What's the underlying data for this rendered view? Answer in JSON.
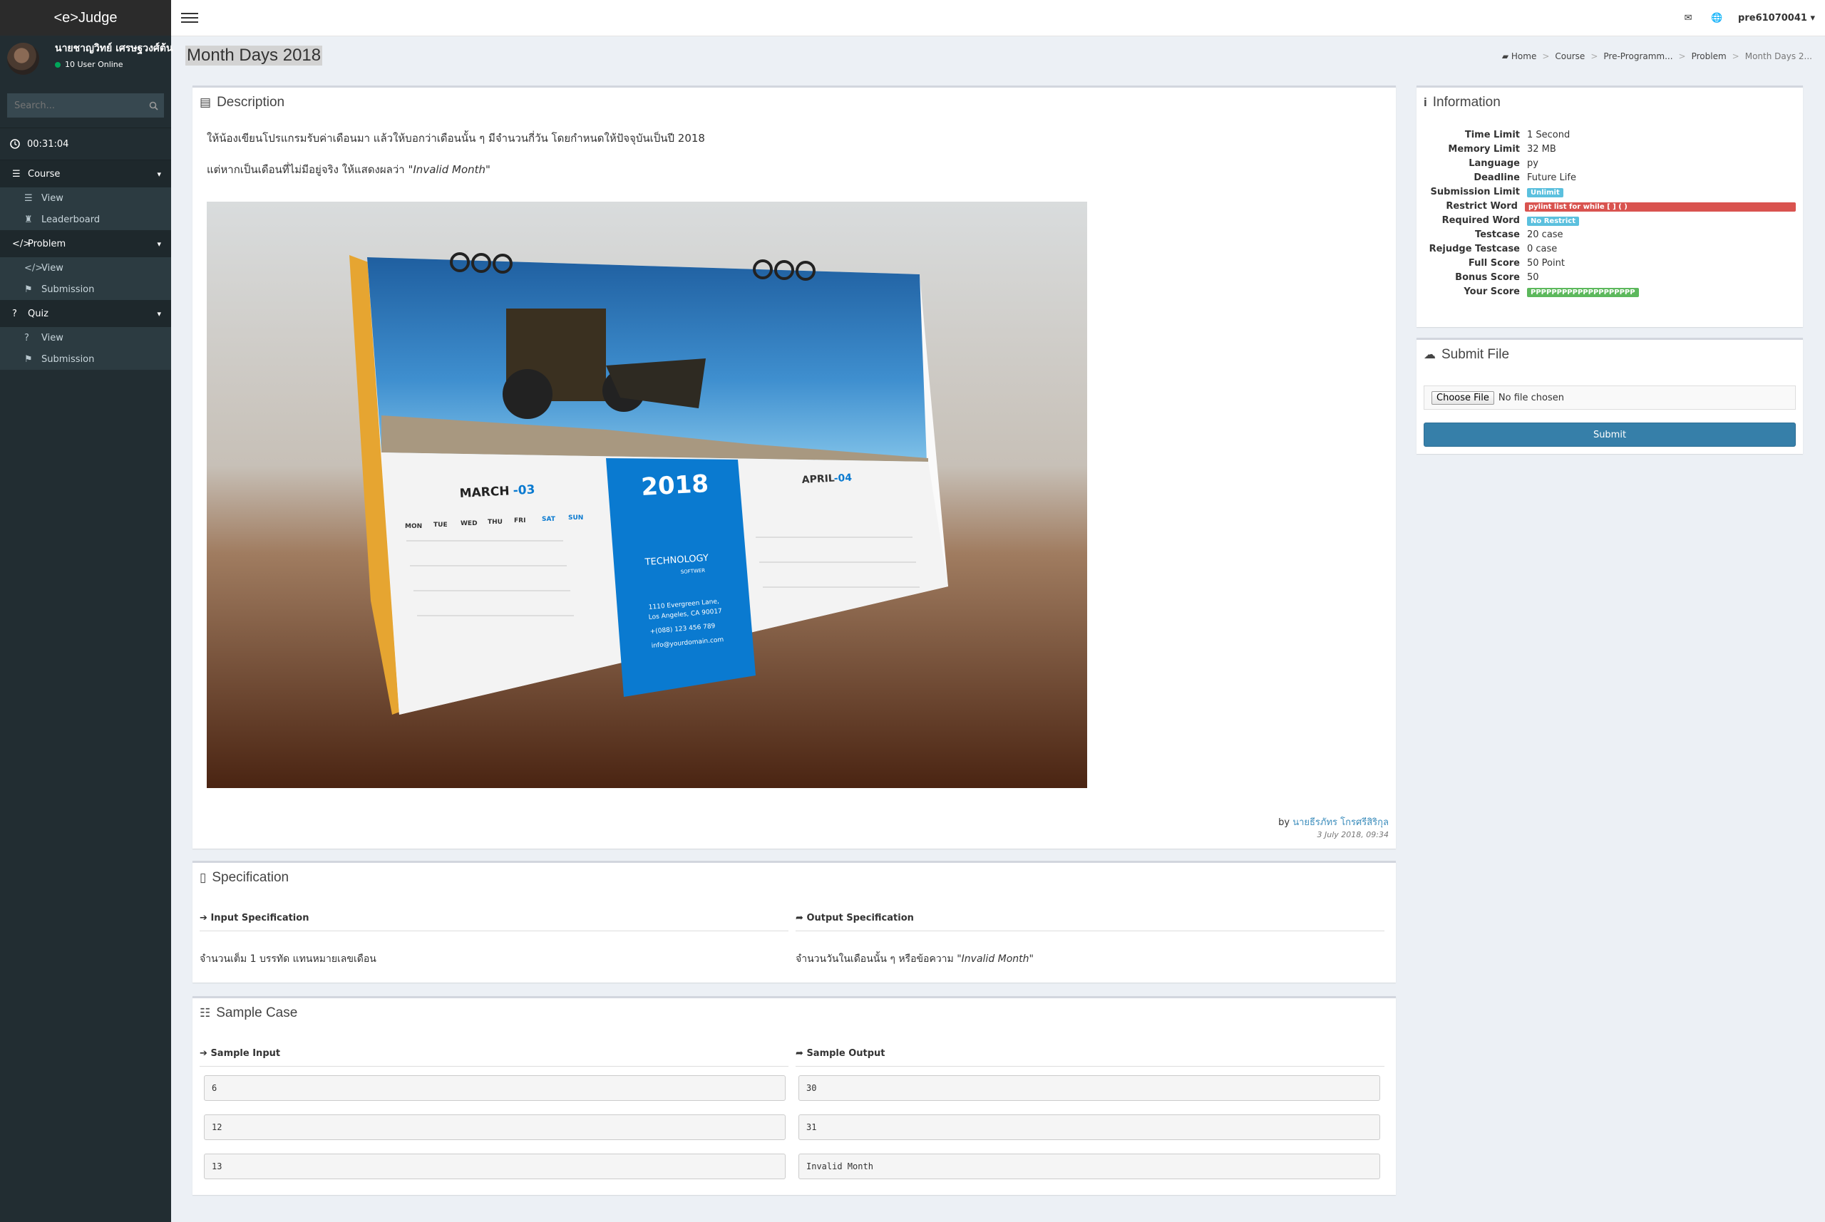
{
  "app": {
    "logo": "<e>Judge"
  },
  "user_panel": {
    "name": "นายชาญวิทย์ เศรษฐวงศ์ต้น",
    "status": "10 User Online"
  },
  "search": {
    "placeholder": "Search..."
  },
  "timer": "00:31:04",
  "menu": [
    {
      "label": "Course",
      "icon": "list-icon",
      "items": [
        {
          "label": "View",
          "icon": "list-icon"
        },
        {
          "label": "Leaderboard",
          "icon": "trophy-icon"
        }
      ]
    },
    {
      "label": "Problem",
      "icon": "code-icon",
      "items": [
        {
          "label": "View",
          "icon": "code-icon"
        },
        {
          "label": "Submission",
          "icon": "flag-icon"
        }
      ]
    },
    {
      "label": "Quiz",
      "icon": "question-icon",
      "items": [
        {
          "label": "View",
          "icon": "question-icon"
        },
        {
          "label": "Submission",
          "icon": "flag-icon"
        }
      ]
    }
  ],
  "topbar": {
    "username": "pre61070041"
  },
  "page": {
    "title": "Month Days 2018"
  },
  "breadcrumb": [
    "Home",
    "Course",
    "Pre-Programm...",
    "Problem",
    "Month Days 2..."
  ],
  "description": {
    "title": "Description",
    "line1": "ให้น้องเขียนโปรแกรมรับค่าเดือนมา แล้วให้บอกว่าเดือนนั้น ๆ มีจำนวนกี่วัน โดยกำหนดให้ปัจจุบันเป็นปี 2018",
    "line2_prefix": "แต่หากเป็นเดือนที่ไม่มีอยู่จริง ให้แสดงผลว่า ",
    "line2_quote": "\"Invalid Month\"",
    "author_prefix": "by ",
    "author": "นายธีรภัทร โกรศรีสิริกุล",
    "date": "3 July 2018, 09:34",
    "image": {
      "month1": "MARCH",
      "month1_num": "-03",
      "month2": "APRIL",
      "month2_num": "-04",
      "year": "2018",
      "brand1": "TECHNOLOGY",
      "brand2": "SOFTWER",
      "addr1": "1110 Evergreen Lane,",
      "addr2": "Los Angeles, CA 90017",
      "phone": "+(088) 123 456 789",
      "email": "info@yourdomain.com",
      "days": [
        "MON",
        "TUE",
        "WED",
        "THU",
        "FRI",
        "SAT",
        "SUN"
      ]
    }
  },
  "specification": {
    "title": "Specification",
    "input_head": "Input Specification",
    "output_head": "Output Specification",
    "input_text": "จำนวนเต็ม 1 บรรทัด แทนหมายเลขเดือน",
    "output_prefix": "จำนวนวันในเดือนนั้น ๆ หรือข้อความ ",
    "output_quote": "\"Invalid Month\""
  },
  "sample": {
    "title": "Sample Case",
    "input_head": "Sample Input",
    "output_head": "Sample Output",
    "rows": [
      {
        "in": "6",
        "out": "30"
      },
      {
        "in": "12",
        "out": "31"
      },
      {
        "in": "13",
        "out": "Invalid Month"
      }
    ]
  },
  "information": {
    "title": "Information",
    "rows": [
      {
        "label": "Time Limit",
        "value": "1 Second"
      },
      {
        "label": "Memory Limit",
        "value": "32 MB"
      },
      {
        "label": "Language",
        "value": "py"
      },
      {
        "label": "Deadline",
        "value": "Future Life"
      },
      {
        "label": "Submission Limit",
        "value": "Unlimit",
        "badge": "#5bc0de"
      },
      {
        "label": "Restrict Word",
        "value": "pylint list for while [ ] ( )",
        "badge": "#d9534f",
        "wide": true
      },
      {
        "label": "Required Word",
        "value": "No Restrict",
        "badge": "#5bc0de"
      },
      {
        "label": "Testcase",
        "value": "20 case"
      },
      {
        "label": "Rejudge Testcase",
        "value": "0 case"
      },
      {
        "label": "Full Score",
        "value": "50 Point"
      },
      {
        "label": "Bonus Score",
        "value": "50"
      },
      {
        "label": "Your Score",
        "value": "PPPPPPPPPPPPPPPPPPPP",
        "badge": "#5cb85c"
      }
    ]
  },
  "submit_file": {
    "title": "Submit File",
    "choose": "Choose File",
    "no_file": "No file chosen",
    "submit": "Submit"
  },
  "colors": {
    "sidebar": "#222d32",
    "accent": "#3c8dbc",
    "submit": "#367fa9"
  }
}
